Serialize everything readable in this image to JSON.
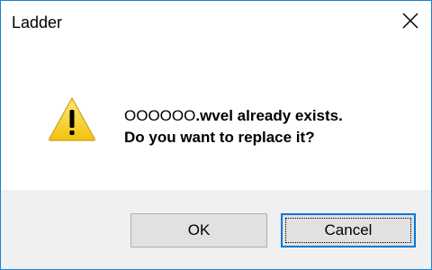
{
  "window": {
    "title": "Ladder",
    "accent_color": "#1883d7"
  },
  "message": {
    "filename": "OOOOOO",
    "line1_rest": ".wvel already exists.",
    "line2": "Do you want to replace it?"
  },
  "icons": {
    "dialog_icon": "warning-icon",
    "close_icon": "close-icon"
  },
  "buttons": {
    "ok_label": "OK",
    "cancel_label": "Cancel",
    "default_button": "cancel",
    "focus_color": "#0078d7"
  }
}
